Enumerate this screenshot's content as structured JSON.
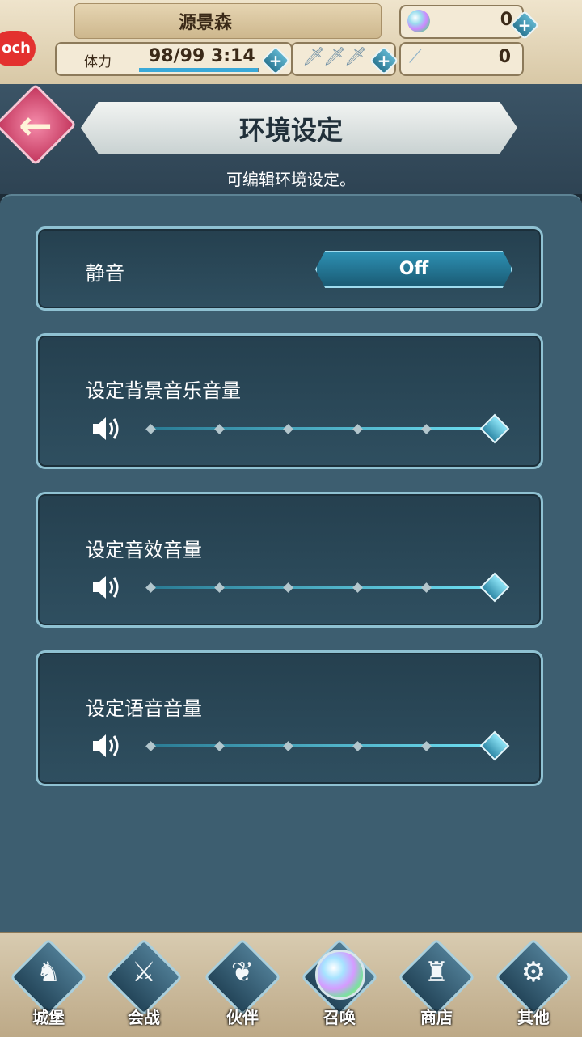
{
  "header": {
    "player_name": "源景森",
    "logo_text": "och",
    "stamina_label": "体力",
    "stamina_value": "98/99",
    "stamina_timer": "3:14",
    "stamina_fraction": 0.99,
    "orb_count": "0",
    "feather_count": "0",
    "plus_label": "+"
  },
  "page": {
    "back_icon": "←",
    "title": "环境设定",
    "subtitle": "可编辑环境设定。"
  },
  "settings": {
    "mute_label": "静音",
    "mute_value": "Off",
    "sliders": [
      {
        "label": "设定背景音乐音量",
        "level": 5,
        "max": 5
      },
      {
        "label": "设定音效音量",
        "level": 5,
        "max": 5
      },
      {
        "label": "设定语音音量",
        "level": 5,
        "max": 5
      }
    ]
  },
  "nav": {
    "items": [
      {
        "label": "城堡",
        "icon": "castle-emblem-icon",
        "glyph": "♞"
      },
      {
        "label": "会战",
        "icon": "crossed-swords-icon",
        "glyph": "⚔"
      },
      {
        "label": "伙伴",
        "icon": "wing-icon",
        "glyph": "❦"
      },
      {
        "label": "召唤",
        "icon": "summon-orb-icon",
        "glyph": ""
      },
      {
        "label": "商店",
        "icon": "shop-castle-icon",
        "glyph": "♜"
      },
      {
        "label": "其他",
        "icon": "gear-icon",
        "glyph": "⚙"
      }
    ]
  },
  "colors": {
    "accent": "#6fe0f3",
    "panel": "#3d5e70",
    "back_button": "#d8507a"
  }
}
